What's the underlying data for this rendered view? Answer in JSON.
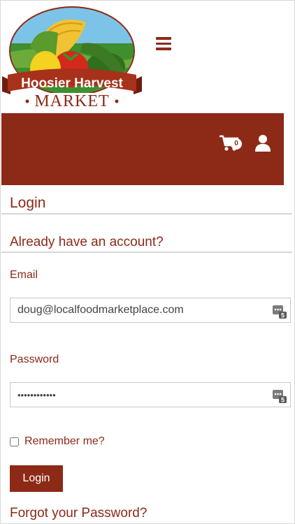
{
  "brand": {
    "logo_line1": "Hoosier Harvest",
    "logo_line2": "MARKET",
    "primary_color": "#8c2a17"
  },
  "header": {
    "menu_icon": "hamburger-icon",
    "cart_icon": "cart-icon",
    "cart_count": "0",
    "user_icon": "user-icon"
  },
  "login": {
    "title": "Login",
    "subtitle": "Already have an account?",
    "email_label": "Email",
    "email_value": "doug@localfoodmarketplace.com",
    "password_label": "Password",
    "password_value": "••••••••••••",
    "remember_label": "Remember me?",
    "remember_checked": false,
    "submit_label": "Login",
    "forgot_label": "Forgot your Password?"
  }
}
